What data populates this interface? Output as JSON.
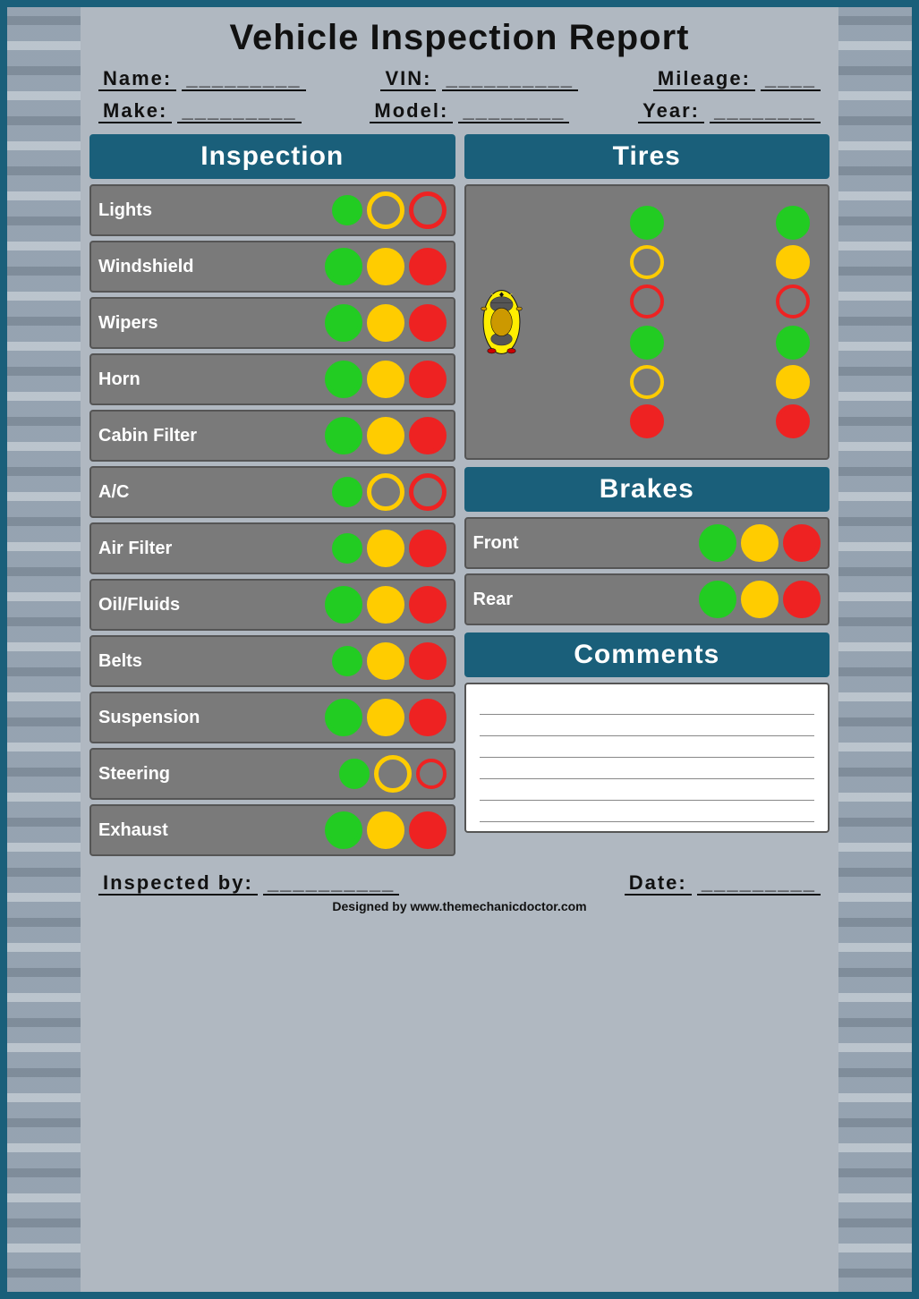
{
  "header": {
    "title": "Vehicle Inspection Report",
    "name_label": "Name:",
    "name_value": "_________",
    "vin_label": "VIN:",
    "vin_value": "__________",
    "mileage_label": "Mileage:",
    "mileage_value": "____",
    "make_label": "Make:",
    "make_value": "_________",
    "model_label": "Model:",
    "model_value": "________",
    "year_label": "Year:",
    "year_value": "________"
  },
  "inspection_section": {
    "title": "Inspection",
    "rows": [
      {
        "label": "Lights",
        "circles": [
          "green",
          "yellow",
          "red"
        ]
      },
      {
        "label": "Windshield",
        "circles": [
          "green",
          "yellow",
          "red"
        ]
      },
      {
        "label": "Wipers",
        "circles": [
          "green",
          "yellow",
          "red"
        ]
      },
      {
        "label": "Horn",
        "circles": [
          "green",
          "yellow",
          "red"
        ]
      },
      {
        "label": "Cabin Filter",
        "circles": [
          "green",
          "yellow",
          "red"
        ]
      },
      {
        "label": "A/C",
        "circles": [
          "green",
          "yellow",
          "red"
        ]
      },
      {
        "label": "Air Filter",
        "circles": [
          "green",
          "yellow",
          "red"
        ]
      },
      {
        "label": "Oil/Fluids",
        "circles": [
          "green",
          "yellow",
          "red"
        ]
      },
      {
        "label": "Belts",
        "circles": [
          "green",
          "yellow",
          "red"
        ]
      },
      {
        "label": "Suspension",
        "circles": [
          "green",
          "yellow",
          "red"
        ]
      },
      {
        "label": "Steering",
        "circles": [
          "green",
          "yellow",
          "red"
        ]
      },
      {
        "label": "Exhaust",
        "circles": [
          "green",
          "yellow",
          "red"
        ]
      }
    ]
  },
  "tires_section": {
    "title": "Tires",
    "front_left": [
      "green",
      "yellow",
      "red"
    ],
    "front_right": [
      "green",
      "yellow",
      "red"
    ],
    "rear_left": [
      "green",
      "yellow",
      "red"
    ],
    "rear_right": [
      "green",
      "yellow",
      "red"
    ]
  },
  "brakes_section": {
    "title": "Brakes",
    "rows": [
      {
        "label": "Front",
        "circles": [
          "green",
          "yellow",
          "red"
        ]
      },
      {
        "label": "Rear",
        "circles": [
          "green",
          "yellow",
          "red"
        ]
      }
    ]
  },
  "comments_section": {
    "title": "Comments",
    "lines": 6
  },
  "footer": {
    "inspected_by_label": "Inspected by:",
    "inspected_by_value": "__________",
    "date_label": "Date:",
    "date_value": "_________",
    "designer": "Designed by www.themechanicdoctor.com"
  }
}
